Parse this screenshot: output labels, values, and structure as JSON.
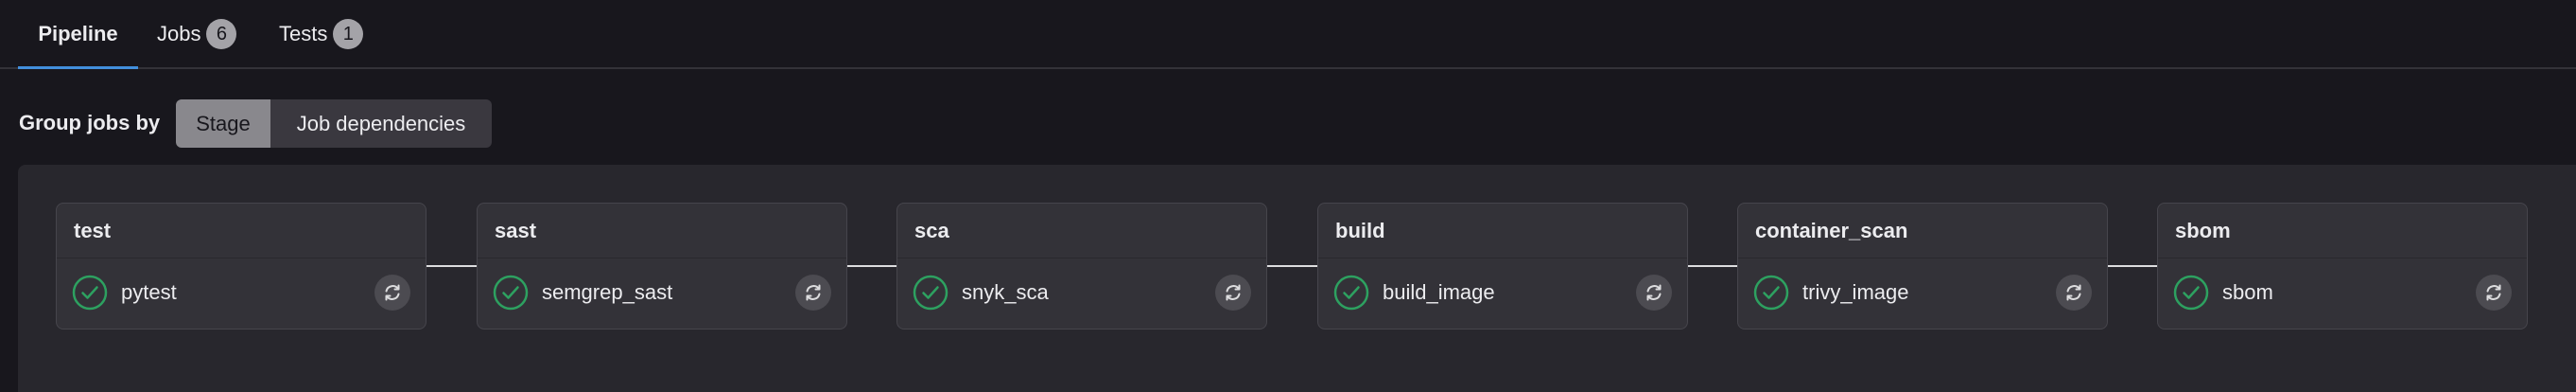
{
  "tabs": [
    {
      "label": "Pipeline",
      "active": true
    },
    {
      "label": "Jobs",
      "count": "6"
    },
    {
      "label": "Tests",
      "count": "1"
    }
  ],
  "group_by": {
    "label": "Group jobs by",
    "options": [
      "Stage",
      "Job dependencies"
    ],
    "selected": "Stage"
  },
  "stages": [
    {
      "name": "test",
      "job": "pytest",
      "status": "passed"
    },
    {
      "name": "sast",
      "job": "semgrep_sast",
      "status": "passed"
    },
    {
      "name": "sca",
      "job": "snyk_sca",
      "status": "passed"
    },
    {
      "name": "build",
      "job": "build_image",
      "status": "passed"
    },
    {
      "name": "container_scan",
      "job": "trivy_image",
      "status": "passed"
    },
    {
      "name": "sbom",
      "job": "sbom",
      "status": "passed"
    }
  ],
  "colors": {
    "success": "#2da160",
    "accent": "#428fdc",
    "background": "#18171d",
    "panel": "#28272d",
    "card": "#333238"
  },
  "icons": {
    "status": "check-circle-icon",
    "retry": "retry-icon"
  }
}
